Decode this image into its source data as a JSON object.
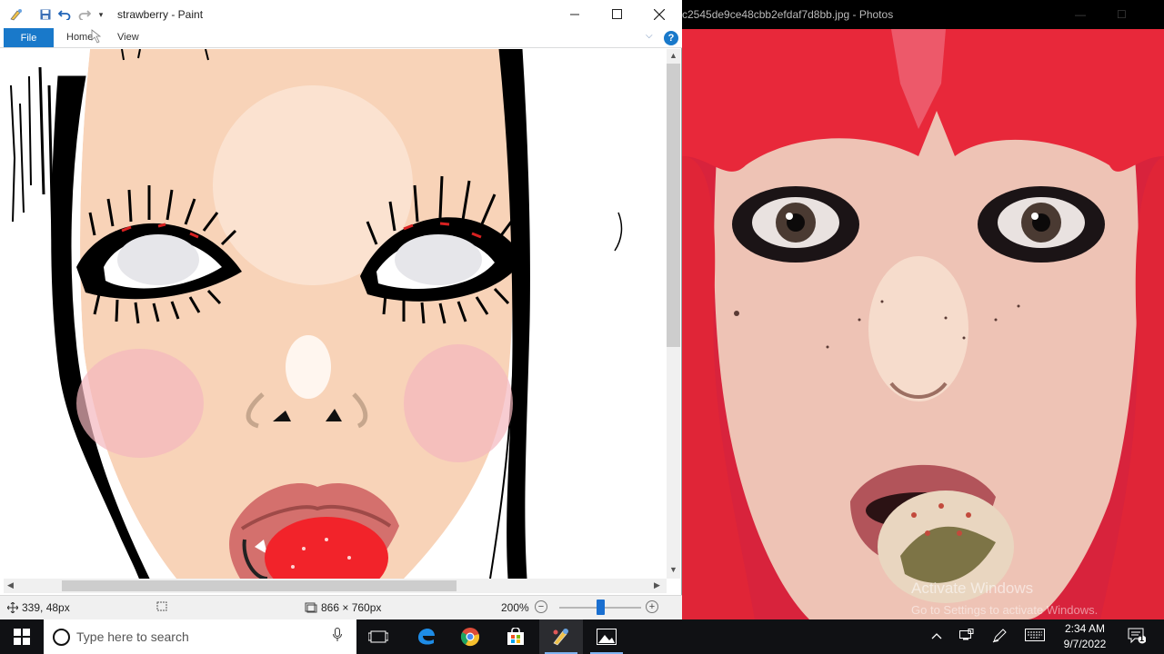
{
  "paint": {
    "title": "strawberry - Paint",
    "tabs": {
      "file": "File",
      "home": "Home",
      "view": "View"
    },
    "help": "?",
    "status": {
      "cursor_pos": "339, 48px",
      "canvas_size": "866 × 760px",
      "zoom": "200%"
    },
    "zoom_level_fraction": 0.5
  },
  "photos": {
    "title": "c2545de9ce48cbb2efdaf7d8bb.jpg - Photos",
    "watermark_line1": "Activate Windows",
    "watermark_line2": "Go to Settings to activate Windows."
  },
  "taskbar": {
    "search_placeholder": "Type here to search",
    "time": "2:34 AM",
    "date": "9/7/2022",
    "notification_count": "1"
  },
  "colors": {
    "accent": "#1979ca",
    "hair": "#e8283a",
    "skin": "#f8d5bd",
    "strawberry": "#f2232a",
    "taskbar": "#101114"
  }
}
